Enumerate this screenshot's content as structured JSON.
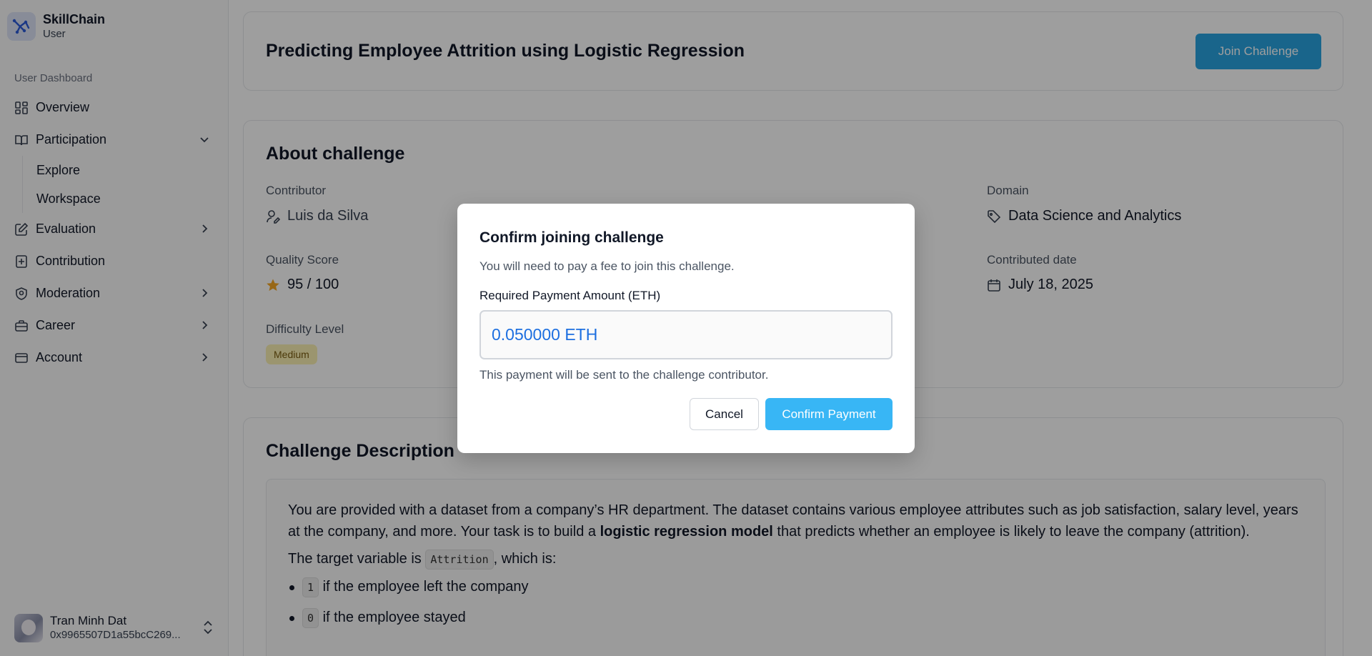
{
  "brand": {
    "name": "SkillChain",
    "role": "User"
  },
  "sidebar": {
    "group_label": "User Dashboard",
    "items": [
      {
        "label": "Overview",
        "icon": "grid-icon"
      },
      {
        "label": "Participation",
        "icon": "book-open-icon",
        "expanded": true,
        "children": [
          {
            "label": "Explore"
          },
          {
            "label": "Workspace"
          }
        ]
      },
      {
        "label": "Evaluation",
        "icon": "edit-icon"
      },
      {
        "label": "Contribution",
        "icon": "plus-square-icon"
      },
      {
        "label": "Moderation",
        "icon": "shield-icon"
      },
      {
        "label": "Career",
        "icon": "briefcase-icon"
      },
      {
        "label": "Account",
        "icon": "card-icon"
      }
    ]
  },
  "user": {
    "name": "Tran Minh Dat",
    "address": "0x9965507D1a55bcC269..."
  },
  "challenge": {
    "title": "Predicting Employee Attrition using Logistic Regression",
    "join_label": "Join Challenge"
  },
  "about": {
    "heading": "About challenge",
    "contributor_label": "Contributor",
    "contributor": "Luis da Silva",
    "domain_label": "Domain",
    "domain": "Data Science and Analytics",
    "quality_label": "Quality Score",
    "quality": "95 / 100",
    "date_label": "Contributed date",
    "date": "July 18, 2025",
    "difficulty_label": "Difficulty Level",
    "difficulty": "Medium"
  },
  "description": {
    "heading": "Challenge Description",
    "p1_a": "You are provided with a dataset from a company’s HR department. The dataset contains various employee attributes such as job satisfaction, salary level, years at the company, and more. Your task is to build a ",
    "p1_bold": "logistic regression model",
    "p1_b": " that predicts whether an employee is likely to leave the company (attrition).",
    "p2_a": "The target variable is ",
    "p2_code": "Attrition",
    "p2_b": ", which is:",
    "list": [
      {
        "code": "1",
        "text": " if the employee left the company"
      },
      {
        "code": "0",
        "text": " if the employee stayed"
      }
    ]
  },
  "modal": {
    "title": "Confirm joining challenge",
    "description": "You will need to pay a fee to join this challenge.",
    "amount_label": "Required Payment Amount (ETH)",
    "amount_value": "0.050000 ETH",
    "note": "This payment will be sent to the challenge contributor.",
    "cancel_label": "Cancel",
    "confirm_label": "Confirm Payment"
  },
  "colors": {
    "accent": "#29a3e0",
    "confirm": "#38b6f5",
    "eth_text": "#1d6fe0",
    "badge_bg": "#fbf1b3",
    "star": "#f5a623"
  }
}
